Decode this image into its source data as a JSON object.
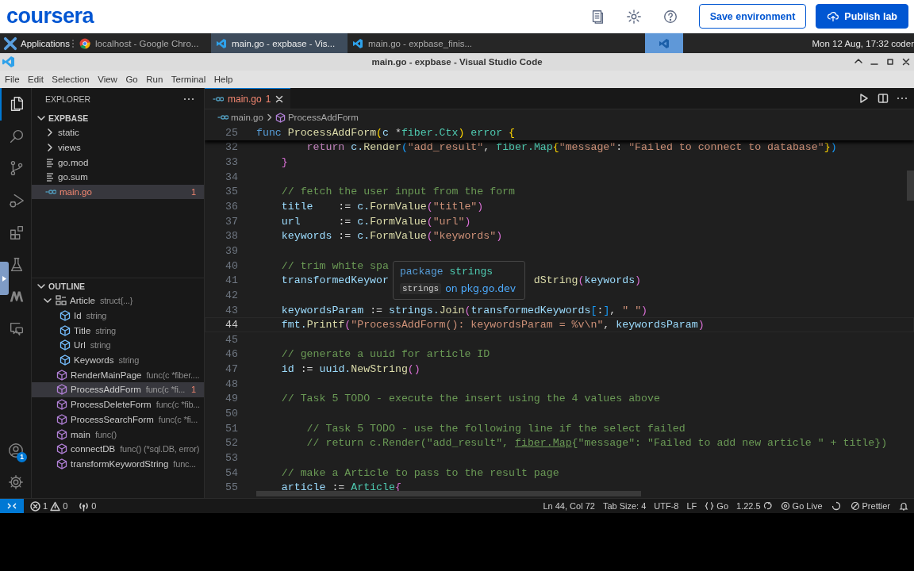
{
  "header": {
    "logo": "coursera",
    "buttons": [
      {
        "label": "Save environment",
        "kind": "secondary"
      },
      {
        "label": "Publish lab",
        "kind": "primary"
      }
    ]
  },
  "taskbar": {
    "menu": "Applications",
    "tasks": [
      {
        "label": "localhost - Google Chro...",
        "kind": "chrome",
        "selected": false
      },
      {
        "label": "main.go - expbase - Vis...",
        "kind": "vscode",
        "selected": true
      },
      {
        "label": "main.go - expbase_finis...",
        "kind": "vscode",
        "selected": false
      }
    ],
    "clock": "Mon 12 Aug, 17:32 coder"
  },
  "window": {
    "title": "main.go - expbase - Visual Studio Code"
  },
  "menu": [
    "File",
    "Edit",
    "Selection",
    "View",
    "Go",
    "Run",
    "Terminal",
    "Help"
  ],
  "activity_bar": {
    "items": [
      {
        "kind": "explorer",
        "selected": true
      },
      {
        "kind": "search",
        "selected": false
      },
      {
        "kind": "source-control",
        "selected": false
      },
      {
        "kind": "run-debug",
        "selected": false
      },
      {
        "kind": "extensions",
        "selected": false
      },
      {
        "kind": "testing",
        "selected": false
      },
      {
        "kind": "m-logo",
        "selected": false
      },
      {
        "kind": "remote",
        "selected": false
      }
    ],
    "account_badge": "1"
  },
  "sidebar": {
    "title": "EXPLORER",
    "folder": {
      "label": "EXPBASE",
      "expanded": true,
      "items": [
        {
          "label": "static",
          "kind": "folder",
          "expanded": false,
          "selected": false
        },
        {
          "label": "views",
          "kind": "folder",
          "expanded": false,
          "selected": false
        },
        {
          "label": "go.mod",
          "kind": "file",
          "selected": false
        },
        {
          "label": "go.sum",
          "kind": "file",
          "selected": false
        },
        {
          "label": "main.go",
          "kind": "go",
          "selected": true,
          "problems": "1"
        }
      ]
    },
    "outline": {
      "label": "OUTLINE",
      "expanded": true,
      "items": [
        {
          "name": "Article",
          "detail": "struct{...}",
          "kind": "struct",
          "expanded": true,
          "selected": false,
          "children": [
            {
              "name": "Id",
              "detail": "string",
              "kind": "field",
              "selected": false
            },
            {
              "name": "Title",
              "detail": "string",
              "kind": "field",
              "selected": false
            },
            {
              "name": "Url",
              "detail": "string",
              "kind": "field",
              "selected": false
            },
            {
              "name": "Keywords",
              "detail": "string",
              "kind": "field",
              "selected": false
            }
          ]
        },
        {
          "name": "RenderMainPage",
          "detail": "func(c *fiber....",
          "kind": "func",
          "selected": false
        },
        {
          "name": "ProcessAddForm",
          "detail": "func(c *fi...",
          "kind": "func",
          "selected": true,
          "problems": "1"
        },
        {
          "name": "ProcessDeleteForm",
          "detail": "func(c *fib...",
          "kind": "func",
          "selected": false
        },
        {
          "name": "ProcessSearchForm",
          "detail": "func(c *fi...",
          "kind": "func",
          "selected": false
        },
        {
          "name": "main",
          "detail": "func()",
          "kind": "func",
          "selected": false
        },
        {
          "name": "connectDB",
          "detail": "func() (*sql.DB, error)",
          "kind": "func",
          "selected": false
        },
        {
          "name": "transformKeywordString",
          "detail": "func...",
          "kind": "func",
          "selected": false
        }
      ]
    }
  },
  "editor": {
    "tabs": [
      {
        "label": "main.go",
        "problems": "1",
        "selected": true
      }
    ],
    "breadcrumb": [
      "main.go",
      "ProcessAddForm"
    ],
    "sticky_line": {
      "number": "25",
      "tokens": [
        {
          "text": "func",
          "kind": "kw"
        },
        {
          "text": " ProcessAddForm",
          "kind": "fn"
        },
        {
          "text": "(",
          "kind": "b1"
        },
        {
          "text": "c",
          "kind": "var"
        },
        {
          "text": " *",
          "kind": "punc"
        },
        {
          "text": "fiber.Ctx",
          "kind": "type"
        },
        {
          "text": ")",
          "kind": "b1"
        },
        {
          "text": " error",
          "kind": "type"
        },
        {
          "text": " {",
          "kind": "b1"
        }
      ]
    },
    "lines": [
      {
        "number": "32",
        "current": false,
        "tokens": [
          {
            "text": "        return",
            "kind": "ctrl"
          },
          {
            "text": " c.",
            "kind": "var"
          },
          {
            "text": "Render",
            "kind": "fn"
          },
          {
            "text": "(",
            "kind": "b3"
          },
          {
            "text": "\"add_result\"",
            "kind": "str"
          },
          {
            "text": ", ",
            "kind": "punc"
          },
          {
            "text": "fiber.Map",
            "kind": "type"
          },
          {
            "text": "{",
            "kind": "b1"
          },
          {
            "text": "\"message\"",
            "kind": "str"
          },
          {
            "text": ": ",
            "kind": "punc"
          },
          {
            "text": "\"Failed to connect to database\"",
            "kind": "str"
          },
          {
            "text": "}",
            "kind": "b1"
          },
          {
            "text": ")",
            "kind": "b3"
          }
        ]
      },
      {
        "number": "33",
        "current": false,
        "tokens": [
          {
            "text": "    }",
            "kind": "b2"
          }
        ]
      },
      {
        "number": "34",
        "current": false
      },
      {
        "number": "35",
        "current": false,
        "tokens": [
          {
            "text": "    // fetch the user input from the form",
            "kind": "com"
          }
        ]
      },
      {
        "number": "36",
        "current": false,
        "tokens": [
          {
            "text": "    title",
            "kind": "var"
          },
          {
            "text": "    := ",
            "kind": "punc"
          },
          {
            "text": "c.",
            "kind": "var"
          },
          {
            "text": "FormValue",
            "kind": "fn"
          },
          {
            "text": "(",
            "kind": "b2"
          },
          {
            "text": "\"title\"",
            "kind": "str"
          },
          {
            "text": ")",
            "kind": "b2"
          }
        ]
      },
      {
        "number": "37",
        "current": false,
        "tokens": [
          {
            "text": "    url",
            "kind": "var"
          },
          {
            "text": "      := ",
            "kind": "punc"
          },
          {
            "text": "c.",
            "kind": "var"
          },
          {
            "text": "FormValue",
            "kind": "fn"
          },
          {
            "text": "(",
            "kind": "b2"
          },
          {
            "text": "\"url\"",
            "kind": "str"
          },
          {
            "text": ")",
            "kind": "b2"
          }
        ]
      },
      {
        "number": "38",
        "current": false,
        "tokens": [
          {
            "text": "    keywords",
            "kind": "var"
          },
          {
            "text": " := ",
            "kind": "punc"
          },
          {
            "text": "c.",
            "kind": "var"
          },
          {
            "text": "FormValue",
            "kind": "fn"
          },
          {
            "text": "(",
            "kind": "b2"
          },
          {
            "text": "\"keywords\"",
            "kind": "str"
          },
          {
            "text": ")",
            "kind": "b2"
          }
        ]
      },
      {
        "number": "39",
        "current": false
      },
      {
        "number": "40",
        "current": false,
        "tokens": [
          {
            "text": "    // trim white spa",
            "kind": "com"
          }
        ]
      },
      {
        "number": "41",
        "current": false,
        "tokens": [
          {
            "text": "    transformedKeywor",
            "kind": "var"
          },
          {
            "text": "dString",
            "kind": "fn",
            "covered_before": true
          },
          {
            "text": "(",
            "kind": "b2"
          },
          {
            "text": "keywords",
            "kind": "var"
          },
          {
            "text": ")",
            "kind": "b2"
          }
        ]
      },
      {
        "number": "42",
        "current": false
      },
      {
        "number": "43",
        "current": false,
        "tokens": [
          {
            "text": "    keywordsParam",
            "kind": "var"
          },
          {
            "text": " := ",
            "kind": "punc"
          },
          {
            "text": "strings.",
            "kind": "var"
          },
          {
            "text": "Join",
            "kind": "fn"
          },
          {
            "text": "(",
            "kind": "b2"
          },
          {
            "text": "transformedKeywords",
            "kind": "var"
          },
          {
            "text": "[",
            "kind": "b3"
          },
          {
            "text": ":",
            "kind": "punc"
          },
          {
            "text": "]",
            "kind": "b3"
          },
          {
            "text": ", ",
            "kind": "punc"
          },
          {
            "text": "\" \"",
            "kind": "str"
          },
          {
            "text": ")",
            "kind": "b2"
          }
        ]
      },
      {
        "number": "44",
        "current": true,
        "tokens": [
          {
            "text": "    fmt.",
            "kind": "var"
          },
          {
            "text": "Printf",
            "kind": "fn"
          },
          {
            "text": "(",
            "kind": "b2"
          },
          {
            "text": "\"ProcessAddForm(): keywordsParam = %v\\n\"",
            "kind": "str"
          },
          {
            "text": ", ",
            "kind": "punc"
          },
          {
            "text": "keywordsParam",
            "kind": "var"
          },
          {
            "text": ")",
            "kind": "b2"
          }
        ]
      },
      {
        "number": "45",
        "current": false
      },
      {
        "number": "46",
        "current": false,
        "tokens": [
          {
            "text": "    // generate a uuid for article ID",
            "kind": "com"
          }
        ]
      },
      {
        "number": "47",
        "current": false,
        "tokens": [
          {
            "text": "    id",
            "kind": "var"
          },
          {
            "text": " := ",
            "kind": "punc"
          },
          {
            "text": "uuid.",
            "kind": "var"
          },
          {
            "text": "NewString",
            "kind": "fn"
          },
          {
            "text": "()",
            "kind": "b2"
          }
        ]
      },
      {
        "number": "48",
        "current": false
      },
      {
        "number": "49",
        "current": false,
        "tokens": [
          {
            "text": "    // Task 5 TODO - execute the insert using the 4 values above",
            "kind": "com"
          }
        ]
      },
      {
        "number": "50",
        "current": false
      },
      {
        "number": "51",
        "current": false,
        "tokens": [
          {
            "text": "        // Task 5 TODO - use the following line if the select failed",
            "kind": "com"
          }
        ]
      },
      {
        "number": "52",
        "current": false,
        "tokens": [
          {
            "text": "        // return c.Render(\"add_result\", ",
            "kind": "com"
          },
          {
            "text": "fiber.Map",
            "kind": "comlink"
          },
          {
            "text": "{\"message\": \"Failed to add new article \" + title})",
            "kind": "com"
          }
        ]
      },
      {
        "number": "53",
        "current": false
      },
      {
        "number": "54",
        "current": false,
        "tokens": [
          {
            "text": "    // make a Article to pass to the result page",
            "kind": "com"
          }
        ]
      },
      {
        "number": "55",
        "current": false,
        "tokens": [
          {
            "text": "    article",
            "kind": "var"
          },
          {
            "text": " := ",
            "kind": "punc"
          },
          {
            "text": "Article",
            "kind": "type"
          },
          {
            "text": "{",
            "kind": "b2"
          }
        ]
      }
    ],
    "hover": {
      "keyword": "package",
      "name": "strings",
      "code": "strings",
      "link": "on pkg.go.dev"
    }
  },
  "status_bar": {
    "errors": "1",
    "warnings": "0",
    "ports": "0",
    "items": [
      {
        "kind": "position",
        "text": "Ln 44, Col 72"
      },
      {
        "kind": "text",
        "text": "Tab Size: 4"
      },
      {
        "kind": "text",
        "text": "UTF-8"
      },
      {
        "kind": "text",
        "text": "LF"
      },
      {
        "kind": "language",
        "text": "Go"
      },
      {
        "kind": "version",
        "text": "1.22.5"
      },
      {
        "kind": "live",
        "text": "Go Live"
      },
      {
        "kind": "spinner"
      },
      {
        "kind": "prettier",
        "text": "Prettier"
      },
      {
        "kind": "bell"
      }
    ]
  }
}
